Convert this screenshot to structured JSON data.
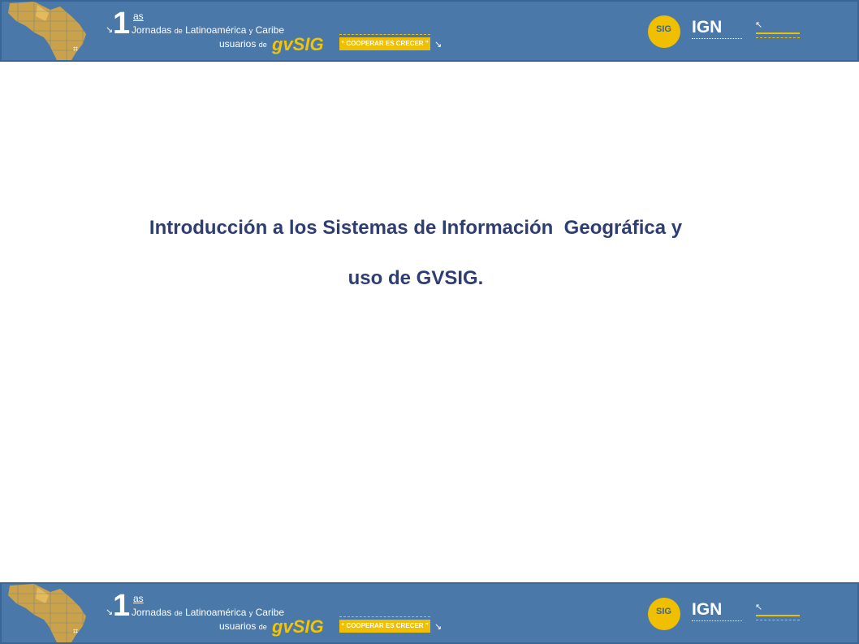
{
  "banner": {
    "edition_number": "1",
    "edition_suffix": "as",
    "line1_word1": "Jornadas",
    "line1_word2": "de",
    "line1_word3": "Latinoamérica",
    "line1_word4": "y",
    "line1_word5": "Caribe",
    "line2_word1": "usuarios",
    "line2_word2": "de",
    "product": "gvSIG",
    "slogan": "“ COOPERAR ES CRECER ”",
    "gvsig_logo_text": "SIG",
    "ign_logo_text": "IGN",
    "accent_color": "#f0c000",
    "background_color": "#4a78a8"
  },
  "slide": {
    "title_line1": "Introducción a los Sistemas de Información  Geográfica y",
    "title_line2": "uso de GVSIG.",
    "title_color": "#2f3e72"
  }
}
